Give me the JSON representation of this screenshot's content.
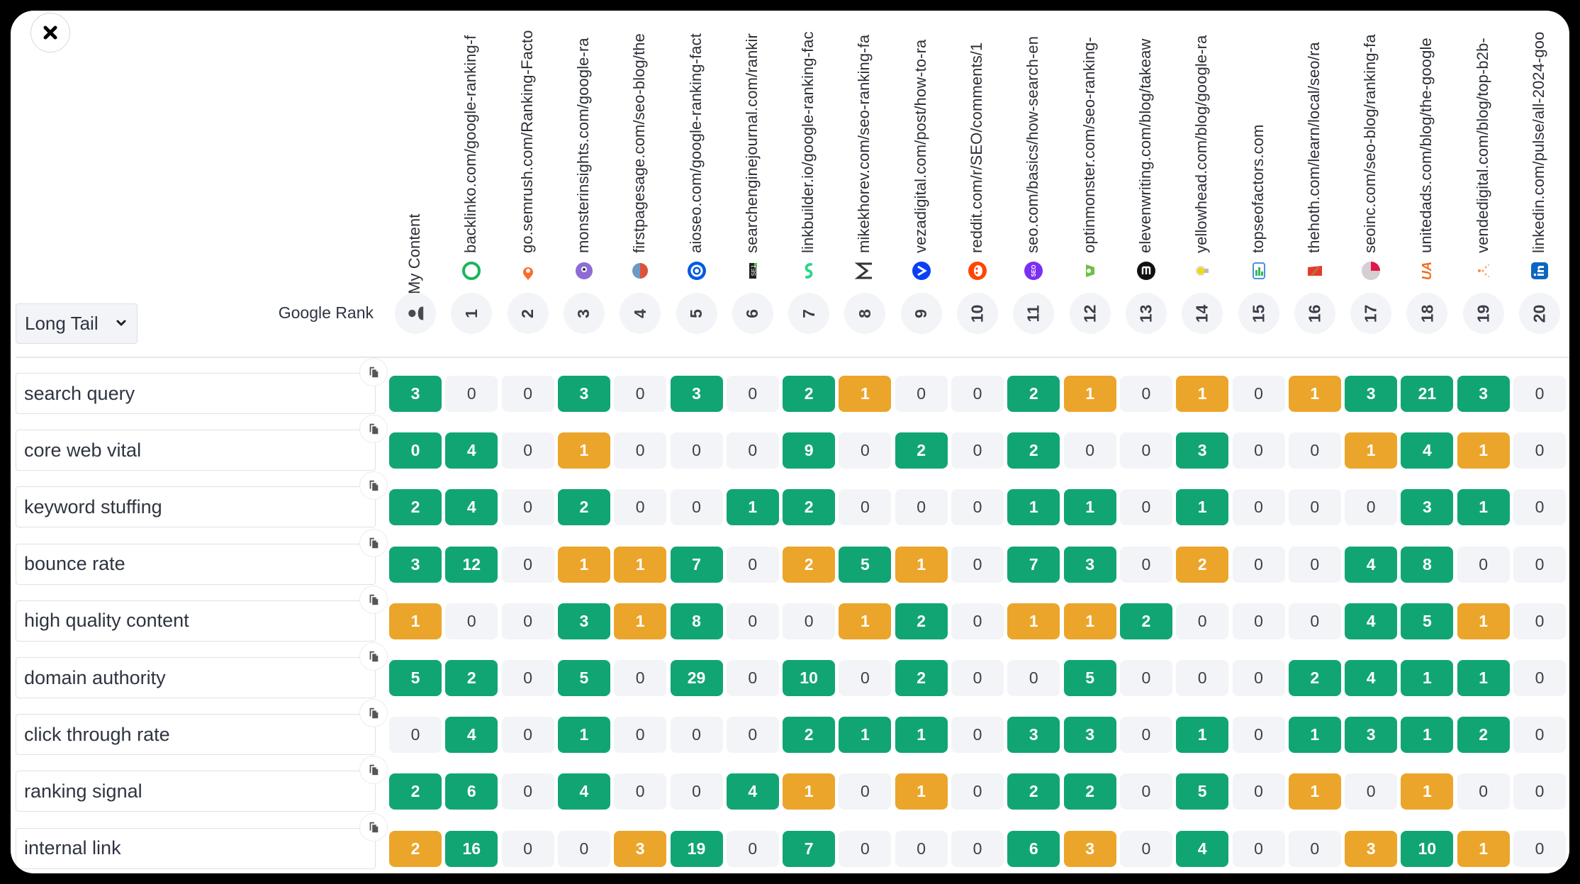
{
  "close_button": {
    "icon": "close-icon"
  },
  "filter": {
    "selected": "Long Tail",
    "icon": "chevron-down-icon"
  },
  "google_rank_label": "Google Rank",
  "colors": {
    "green": "#12a574",
    "orange": "#eba52a",
    "zero": "#f3f4f7"
  },
  "my_content": {
    "label": "My Content",
    "rank_icon": "user-icon"
  },
  "columns": [
    {
      "rank": "1",
      "url": "backlinko.com/google-ranking-f",
      "favicon": "backlinko-icon"
    },
    {
      "rank": "2",
      "url": "go.semrush.com/Ranking-Facto",
      "favicon": "semrush-icon"
    },
    {
      "rank": "3",
      "url": "monsterinsights.com/google-ra",
      "favicon": "monsterinsights-icon"
    },
    {
      "rank": "4",
      "url": "firstpagesage.com/seo-blog/the",
      "favicon": "firstpagesage-icon"
    },
    {
      "rank": "5",
      "url": "aioseo.com/google-ranking-fact",
      "favicon": "aioseo-icon"
    },
    {
      "rank": "6",
      "url": "searchenginejournal.com/rankir",
      "favicon": "sej-icon"
    },
    {
      "rank": "7",
      "url": "linkbuilder.io/google-ranking-fac",
      "favicon": "linkbuilder-icon"
    },
    {
      "rank": "8",
      "url": "mikekhorev.com/seo-ranking-fa",
      "favicon": "mikekhorev-icon"
    },
    {
      "rank": "9",
      "url": "vezadigital.com/post/how-to-ra",
      "favicon": "vezadigital-icon"
    },
    {
      "rank": "10",
      "url": "reddit.com/r/SEO/comments/1",
      "favicon": "reddit-icon"
    },
    {
      "rank": "11",
      "url": "seo.com/basics/how-search-en",
      "favicon": "seo-com-icon"
    },
    {
      "rank": "12",
      "url": "optinmonster.com/seo-ranking-",
      "favicon": "optinmonster-icon"
    },
    {
      "rank": "13",
      "url": "elevenwriting.com/blog/takeaw",
      "favicon": "elevenwriting-icon"
    },
    {
      "rank": "14",
      "url": "yellowhead.com/blog/google-ra",
      "favicon": "yellowhead-icon"
    },
    {
      "rank": "15",
      "url": "topseofactors.com",
      "favicon": "topseofactors-icon"
    },
    {
      "rank": "16",
      "url": "thehoth.com/learn/local/seo/ra",
      "favicon": "thehoth-icon"
    },
    {
      "rank": "17",
      "url": "seoinc.com/seo-blog/ranking-fa",
      "favicon": "seoinc-icon"
    },
    {
      "rank": "18",
      "url": "unitedads.com/blog/the-google",
      "favicon": "unitedads-icon"
    },
    {
      "rank": "19",
      "url": "vendedigital.com/blog/top-b2b-",
      "favicon": "vendedigital-icon"
    },
    {
      "rank": "20",
      "url": "linkedin.com/pulse/all-2024-goo",
      "favicon": "linkedin-icon"
    }
  ],
  "rows": [
    {
      "keyword": "search query",
      "cells": [
        [
          "3",
          "green"
        ],
        [
          "0",
          "zero"
        ],
        [
          "0",
          "zero"
        ],
        [
          "3",
          "green"
        ],
        [
          "0",
          "zero"
        ],
        [
          "3",
          "green"
        ],
        [
          "0",
          "zero"
        ],
        [
          "2",
          "green"
        ],
        [
          "1",
          "orange"
        ],
        [
          "0",
          "zero"
        ],
        [
          "0",
          "zero"
        ],
        [
          "2",
          "green"
        ],
        [
          "1",
          "orange"
        ],
        [
          "0",
          "zero"
        ],
        [
          "1",
          "orange"
        ],
        [
          "0",
          "zero"
        ],
        [
          "1",
          "orange"
        ],
        [
          "3",
          "green"
        ],
        [
          "21",
          "green"
        ],
        [
          "3",
          "green"
        ],
        [
          "0",
          "zero"
        ]
      ]
    },
    {
      "keyword": "core web vital",
      "cells": [
        [
          "0",
          "green"
        ],
        [
          "4",
          "green"
        ],
        [
          "0",
          "zero"
        ],
        [
          "1",
          "orange"
        ],
        [
          "0",
          "zero"
        ],
        [
          "0",
          "zero"
        ],
        [
          "0",
          "zero"
        ],
        [
          "9",
          "green"
        ],
        [
          "0",
          "zero"
        ],
        [
          "2",
          "green"
        ],
        [
          "0",
          "zero"
        ],
        [
          "2",
          "green"
        ],
        [
          "0",
          "zero"
        ],
        [
          "0",
          "zero"
        ],
        [
          "3",
          "green"
        ],
        [
          "0",
          "zero"
        ],
        [
          "0",
          "zero"
        ],
        [
          "1",
          "orange"
        ],
        [
          "4",
          "green"
        ],
        [
          "1",
          "orange"
        ],
        [
          "0",
          "zero"
        ]
      ]
    },
    {
      "keyword": "keyword stuffing",
      "cells": [
        [
          "2",
          "green"
        ],
        [
          "4",
          "green"
        ],
        [
          "0",
          "zero"
        ],
        [
          "2",
          "green"
        ],
        [
          "0",
          "zero"
        ],
        [
          "0",
          "zero"
        ],
        [
          "1",
          "green"
        ],
        [
          "2",
          "green"
        ],
        [
          "0",
          "zero"
        ],
        [
          "0",
          "zero"
        ],
        [
          "0",
          "zero"
        ],
        [
          "1",
          "green"
        ],
        [
          "1",
          "green"
        ],
        [
          "0",
          "zero"
        ],
        [
          "1",
          "green"
        ],
        [
          "0",
          "zero"
        ],
        [
          "0",
          "zero"
        ],
        [
          "0",
          "zero"
        ],
        [
          "3",
          "green"
        ],
        [
          "1",
          "green"
        ],
        [
          "0",
          "zero"
        ]
      ]
    },
    {
      "keyword": "bounce rate",
      "cells": [
        [
          "3",
          "green"
        ],
        [
          "12",
          "green"
        ],
        [
          "0",
          "zero"
        ],
        [
          "1",
          "orange"
        ],
        [
          "1",
          "orange"
        ],
        [
          "7",
          "green"
        ],
        [
          "0",
          "zero"
        ],
        [
          "2",
          "orange"
        ],
        [
          "5",
          "green"
        ],
        [
          "1",
          "orange"
        ],
        [
          "0",
          "zero"
        ],
        [
          "7",
          "green"
        ],
        [
          "3",
          "green"
        ],
        [
          "0",
          "zero"
        ],
        [
          "2",
          "orange"
        ],
        [
          "0",
          "zero"
        ],
        [
          "0",
          "zero"
        ],
        [
          "4",
          "green"
        ],
        [
          "8",
          "green"
        ],
        [
          "0",
          "zero"
        ],
        [
          "0",
          "zero"
        ]
      ]
    },
    {
      "keyword": "high quality content",
      "cells": [
        [
          "1",
          "orange"
        ],
        [
          "0",
          "zero"
        ],
        [
          "0",
          "zero"
        ],
        [
          "3",
          "green"
        ],
        [
          "1",
          "orange"
        ],
        [
          "8",
          "green"
        ],
        [
          "0",
          "zero"
        ],
        [
          "0",
          "zero"
        ],
        [
          "1",
          "orange"
        ],
        [
          "2",
          "green"
        ],
        [
          "0",
          "zero"
        ],
        [
          "1",
          "orange"
        ],
        [
          "1",
          "orange"
        ],
        [
          "2",
          "green"
        ],
        [
          "0",
          "zero"
        ],
        [
          "0",
          "zero"
        ],
        [
          "0",
          "zero"
        ],
        [
          "4",
          "green"
        ],
        [
          "5",
          "green"
        ],
        [
          "1",
          "orange"
        ],
        [
          "0",
          "zero"
        ]
      ]
    },
    {
      "keyword": "domain authority",
      "cells": [
        [
          "5",
          "green"
        ],
        [
          "2",
          "green"
        ],
        [
          "0",
          "zero"
        ],
        [
          "5",
          "green"
        ],
        [
          "0",
          "zero"
        ],
        [
          "29",
          "green"
        ],
        [
          "0",
          "zero"
        ],
        [
          "10",
          "green"
        ],
        [
          "0",
          "zero"
        ],
        [
          "2",
          "green"
        ],
        [
          "0",
          "zero"
        ],
        [
          "0",
          "zero"
        ],
        [
          "5",
          "green"
        ],
        [
          "0",
          "zero"
        ],
        [
          "0",
          "zero"
        ],
        [
          "0",
          "zero"
        ],
        [
          "2",
          "green"
        ],
        [
          "4",
          "green"
        ],
        [
          "1",
          "green"
        ],
        [
          "1",
          "green"
        ],
        [
          "0",
          "zero"
        ]
      ]
    },
    {
      "keyword": "click through rate",
      "cells": [
        [
          "0",
          "zero"
        ],
        [
          "4",
          "green"
        ],
        [
          "0",
          "zero"
        ],
        [
          "1",
          "green"
        ],
        [
          "0",
          "zero"
        ],
        [
          "0",
          "zero"
        ],
        [
          "0",
          "zero"
        ],
        [
          "2",
          "green"
        ],
        [
          "1",
          "green"
        ],
        [
          "1",
          "green"
        ],
        [
          "0",
          "zero"
        ],
        [
          "3",
          "green"
        ],
        [
          "3",
          "green"
        ],
        [
          "0",
          "zero"
        ],
        [
          "1",
          "green"
        ],
        [
          "0",
          "zero"
        ],
        [
          "1",
          "green"
        ],
        [
          "3",
          "green"
        ],
        [
          "1",
          "green"
        ],
        [
          "2",
          "green"
        ],
        [
          "0",
          "zero"
        ]
      ]
    },
    {
      "keyword": "ranking signal",
      "cells": [
        [
          "2",
          "green"
        ],
        [
          "6",
          "green"
        ],
        [
          "0",
          "zero"
        ],
        [
          "4",
          "green"
        ],
        [
          "0",
          "zero"
        ],
        [
          "0",
          "zero"
        ],
        [
          "4",
          "green"
        ],
        [
          "1",
          "orange"
        ],
        [
          "0",
          "zero"
        ],
        [
          "1",
          "orange"
        ],
        [
          "0",
          "zero"
        ],
        [
          "2",
          "green"
        ],
        [
          "2",
          "green"
        ],
        [
          "0",
          "zero"
        ],
        [
          "5",
          "green"
        ],
        [
          "0",
          "zero"
        ],
        [
          "1",
          "orange"
        ],
        [
          "0",
          "zero"
        ],
        [
          "1",
          "orange"
        ],
        [
          "0",
          "zero"
        ],
        [
          "0",
          "zero"
        ]
      ]
    },
    {
      "keyword": "internal link",
      "cells": [
        [
          "2",
          "orange"
        ],
        [
          "16",
          "green"
        ],
        [
          "0",
          "zero"
        ],
        [
          "0",
          "zero"
        ],
        [
          "3",
          "orange"
        ],
        [
          "19",
          "green"
        ],
        [
          "0",
          "zero"
        ],
        [
          "7",
          "green"
        ],
        [
          "0",
          "zero"
        ],
        [
          "0",
          "zero"
        ],
        [
          "0",
          "zero"
        ],
        [
          "6",
          "green"
        ],
        [
          "3",
          "orange"
        ],
        [
          "0",
          "zero"
        ],
        [
          "4",
          "green"
        ],
        [
          "0",
          "zero"
        ],
        [
          "0",
          "zero"
        ],
        [
          "3",
          "orange"
        ],
        [
          "10",
          "green"
        ],
        [
          "1",
          "orange"
        ],
        [
          "0",
          "zero"
        ]
      ]
    }
  ]
}
